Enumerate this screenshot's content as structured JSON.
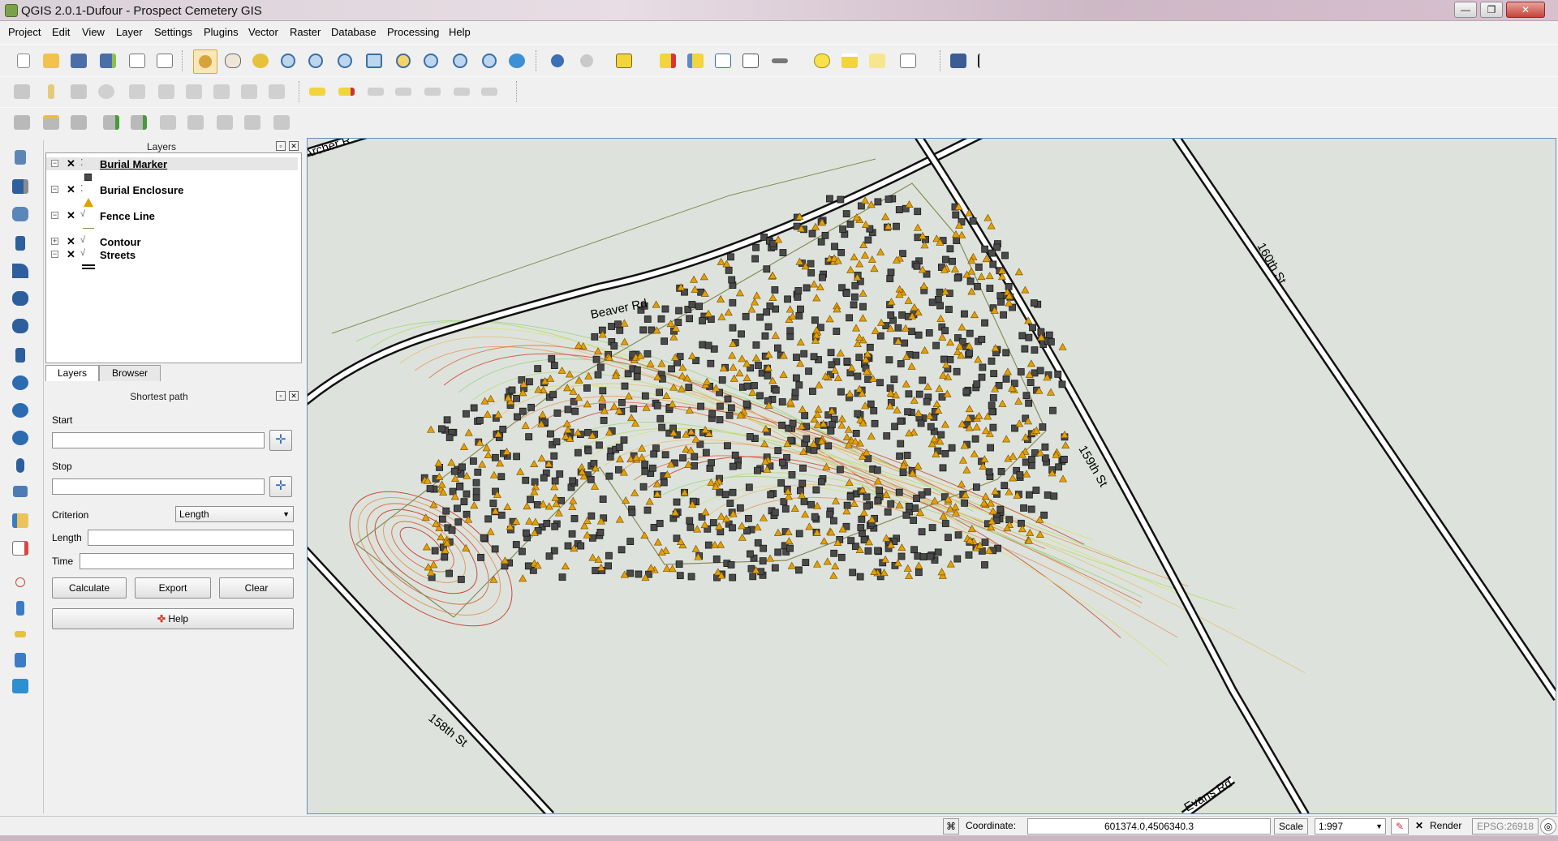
{
  "window": {
    "title": "QGIS 2.0.1-Dufour - Prospect Cemetery GIS",
    "minimize": "—",
    "maximize": "❐",
    "close": "✕"
  },
  "menu": [
    "Project",
    "Edit",
    "View",
    "Layer",
    "Settings",
    "Plugins",
    "Vector",
    "Raster",
    "Database",
    "Processing",
    "Help"
  ],
  "layers_dock": {
    "title": "Layers",
    "layers": [
      {
        "name": "Burial Marker",
        "checked": "✕",
        "expander": "−",
        "geom_icon": "point-layer-icon",
        "legend": "square"
      },
      {
        "name": "Burial Enclosure",
        "checked": "✕",
        "expander": "−",
        "geom_icon": "point-layer-icon",
        "legend": "triangle"
      },
      {
        "name": "Fence Line",
        "checked": "✕",
        "expander": "−",
        "geom_icon": "line-layer-icon",
        "legend": "line"
      },
      {
        "name": "Contour",
        "checked": "✕",
        "expander": "+",
        "geom_icon": "line-layer-icon",
        "legend": ""
      },
      {
        "name": "Streets",
        "checked": "✕",
        "expander": "−",
        "geom_icon": "line-layer-icon",
        "legend": "double-line"
      }
    ],
    "tabs": [
      "Layers",
      "Browser"
    ]
  },
  "shortest_path": {
    "title": "Shortest path",
    "start_label": "Start",
    "start_value": "",
    "stop_label": "Stop",
    "stop_value": "",
    "criterion_label": "Criterion",
    "criterion_value": "Length",
    "length_label": "Length",
    "length_value": "",
    "time_label": "Time",
    "time_value": "",
    "calculate": "Calculate",
    "export": "Export",
    "clear": "Clear",
    "help": "Help"
  },
  "map": {
    "street_labels": [
      "Beaver Rd",
      "160th St",
      "159th St",
      "158th St",
      "Evans Rd",
      "Archer R"
    ],
    "colors": {
      "background": "#dde3dc",
      "marker": "#4a4a4a",
      "enclosure": "#e69f00",
      "fence": "#8a8a55"
    }
  },
  "statusbar": {
    "coordinate_label": "Coordinate:",
    "coordinate_value": "601374.0,4506340.3",
    "scale_label": "Scale",
    "scale_value": "1:997",
    "render_label": "Render",
    "render_checked": "✕",
    "crs": "EPSG:26918"
  }
}
